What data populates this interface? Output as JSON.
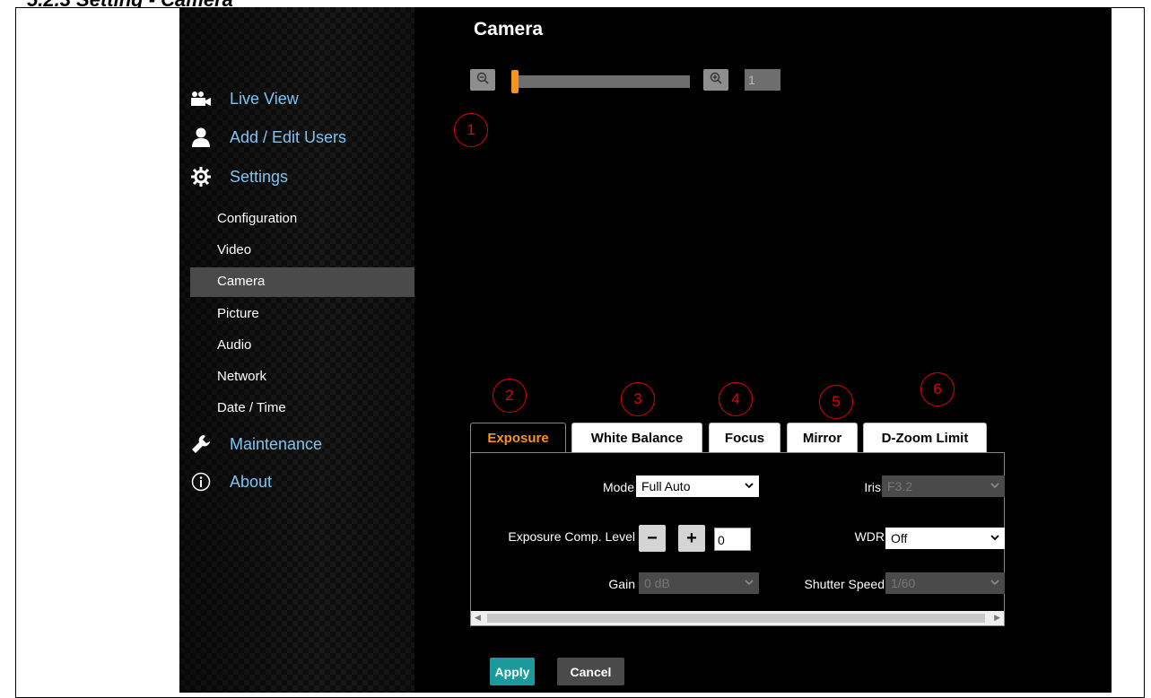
{
  "doc_heading": "5.2.3 Setting - Camera",
  "sidebar": {
    "main_items": [
      {
        "label": "Live View",
        "icon": "video-camera-icon"
      },
      {
        "label": "Add / Edit Users",
        "icon": "user-icon"
      },
      {
        "label": "Settings",
        "icon": "gear-icon"
      },
      {
        "label": "Maintenance",
        "icon": "wrench-icon"
      },
      {
        "label": "About",
        "icon": "info-icon"
      }
    ],
    "sub_items": [
      "Configuration",
      "Video",
      "Camera",
      "Picture",
      "Audio",
      "Network",
      "Date / Time"
    ],
    "active_sub_item": "Camera"
  },
  "page": {
    "title": "Camera"
  },
  "zoom": {
    "value": "1",
    "level_fraction": 0.0,
    "zoom_out_icon": "zoom-out-icon",
    "zoom_in_icon": "zoom-in-icon"
  },
  "callouts": [
    "1",
    "2",
    "3",
    "4",
    "5",
    "6"
  ],
  "tabs": [
    {
      "label": "Exposure",
      "active": true
    },
    {
      "label": "White Balance",
      "active": false
    },
    {
      "label": "Focus",
      "active": false
    },
    {
      "label": "Mirror",
      "active": false
    },
    {
      "label": "D-Zoom Limit",
      "active": false
    }
  ],
  "exposure": {
    "mode_label": "Mode",
    "mode_value": "Full Auto",
    "iris_label": "Iris",
    "iris_value": "F3.2",
    "comp_label": "Exposure Comp. Level",
    "comp_minus": "−",
    "comp_plus": "+",
    "comp_value": "0",
    "wdr_label": "WDR",
    "wdr_value": "Off",
    "gain_label": "Gain",
    "gain_value": "0 dB",
    "shutter_label": "Shutter Speed",
    "shutter_value": "1/60"
  },
  "buttons": {
    "apply": "Apply",
    "cancel": "Cancel"
  },
  "colors": {
    "accent": "#f7941d",
    "nav_link": "#7ec4f2",
    "apply": "#1a9a9a",
    "callout": "#e00000"
  }
}
